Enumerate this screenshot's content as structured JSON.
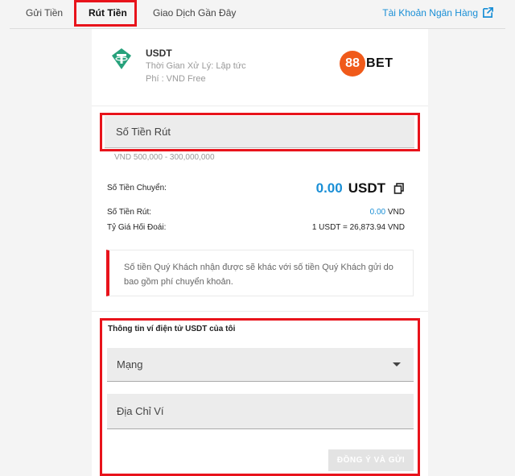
{
  "nav": {
    "tabs": [
      {
        "label": "Gửi Tiền"
      },
      {
        "label": "Rút Tiền"
      },
      {
        "label": "Giao Dịch Gần Đây"
      }
    ],
    "bank_link": "Tài Khoản Ngân Hàng"
  },
  "coin": {
    "name": "USDT",
    "processing_time": "Thời Gian Xử Lý: Lập tức",
    "fee": "Phí : VND Free"
  },
  "brand": {
    "badge": "88",
    "text": "BET"
  },
  "amount": {
    "placeholder": "Số Tiền Rút",
    "range": "VND 500,000 - 300,000,000"
  },
  "summary": {
    "transfer_label": "Số Tiền Chuyển:",
    "transfer_value": "0.00",
    "transfer_unit": "USDT",
    "withdraw_label": "Số Tiền Rút:",
    "withdraw_value": "0.00",
    "withdraw_unit": "VND",
    "rate_label": "Tỷ Giá Hối Đoái:",
    "rate_value": "1 USDT = 26,873.94 VND"
  },
  "notice": "Số tiền Quý Khách nhận được sẽ khác với số tiền Quý Khách gửi do bao gồm phí chuyển khoản.",
  "wallet": {
    "title": "Thông tin ví điện tử USDT của tôi",
    "network_placeholder": "Mạng",
    "address_placeholder": "Địa Chỉ Ví",
    "submit_label": "ĐỒNG Ý VÀ GỬI"
  },
  "colors": {
    "accent": "#1a8fd6",
    "highlight": "#e8131b",
    "brand": "#f05a1a"
  }
}
